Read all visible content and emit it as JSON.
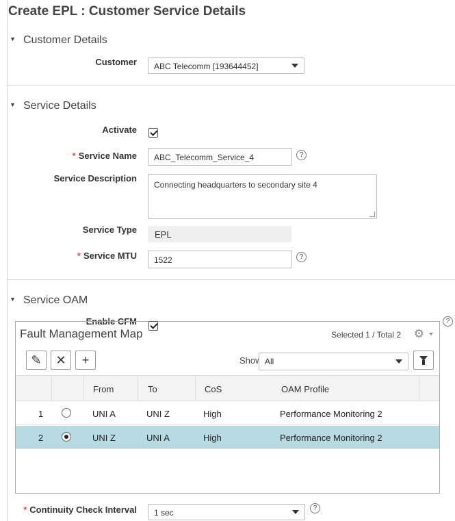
{
  "page": {
    "title": "Create EPL  : Customer Service Details"
  },
  "customer_section": {
    "header": "Customer Details",
    "customer_label": "Customer",
    "customer_value": "ABC Telecomm [193644452]"
  },
  "service_section": {
    "header": "Service Details",
    "activate_label": "Activate",
    "activate_checked": true,
    "service_name_label": "Service Name",
    "service_name_value": "ABC_Telecomm_Service_4",
    "service_description_label": "Service Description",
    "service_description_value": "Connecting headquarters to secondary site 4",
    "service_type_label": "Service Type",
    "service_type_value": "EPL",
    "service_mtu_label": "Service MTU",
    "service_mtu_value": "1522"
  },
  "oam_section": {
    "header": "Service OAM",
    "enable_cfm_label": "Enable CFM",
    "enable_cfm_checked": true
  },
  "fault_map": {
    "title": "Fault Management Map",
    "selected_text": "Selected 1 / Total 2",
    "show_label": "Show",
    "show_value": "All",
    "columns": [
      "From",
      "To",
      "CoS",
      "OAM Profile"
    ],
    "rows": [
      {
        "index": "1",
        "selected": false,
        "from": "UNI A",
        "to": "UNI Z",
        "cos": "High",
        "profile": "Performance Monitoring 2"
      },
      {
        "index": "2",
        "selected": true,
        "from": "UNI Z",
        "to": "UNI A",
        "cos": "High",
        "profile": "Performance Monitoring 2"
      }
    ]
  },
  "continuity": {
    "label": "Continuity Check Interval",
    "value": "1 sec"
  },
  "help_glyph": "?",
  "required_glyph": "*",
  "icons": {
    "edit": "pencil-icon",
    "delete": "x-icon",
    "add": "plus-icon",
    "settings": "gear-icon",
    "filter": "funnel-icon"
  }
}
